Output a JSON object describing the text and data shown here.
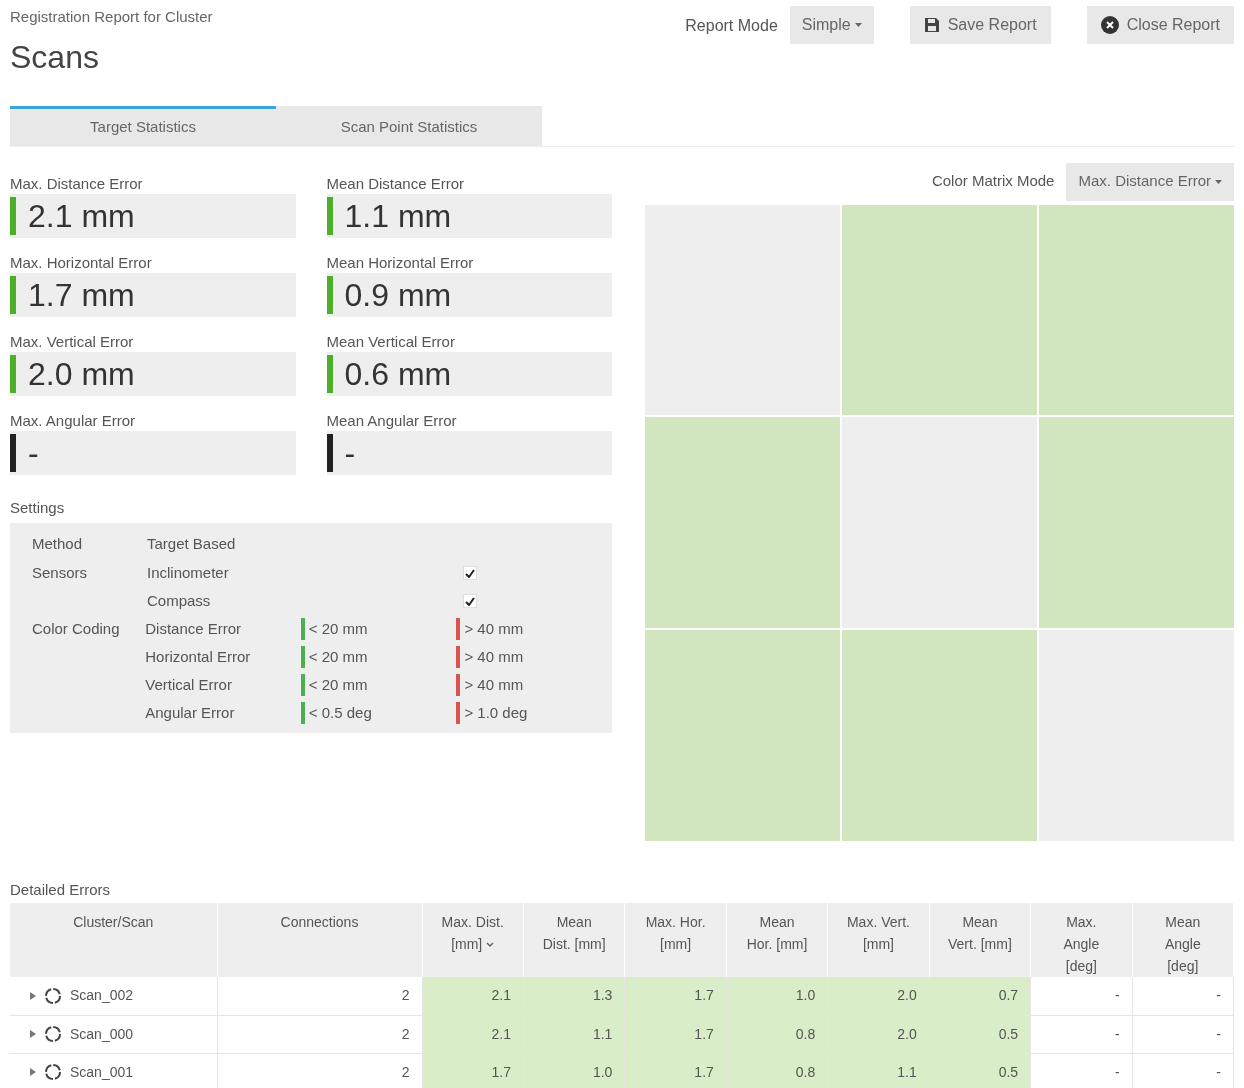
{
  "header": {
    "subtitle": "Registration Report for Cluster",
    "title": "Scans",
    "report_mode_label": "Report Mode",
    "report_mode": "Simple",
    "save_button": "Save Report",
    "close_button": "Close Report"
  },
  "tabs": [
    {
      "label": "Target Statistics",
      "selected": true
    },
    {
      "label": "Scan Point Statistics",
      "selected": false
    }
  ],
  "stats": [
    {
      "label": "Max. Distance Error",
      "value": "2.1 mm",
      "color": "#4caf2a"
    },
    {
      "label": "Mean Distance Error",
      "value": "1.1 mm",
      "color": "#4caf2a"
    },
    {
      "label": "Max. Horizontal Error",
      "value": "1.7 mm",
      "color": "#4caf2a"
    },
    {
      "label": "Mean Horizontal Error",
      "value": "0.9 mm",
      "color": "#4caf2a"
    },
    {
      "label": "Max. Vertical Error",
      "value": "2.0 mm",
      "color": "#4caf2a"
    },
    {
      "label": "Mean Vertical Error",
      "value": "0.6 mm",
      "color": "#4caf2a"
    },
    {
      "label": "Max. Angular Error",
      "value": "-",
      "color": "#222222"
    },
    {
      "label": "Mean Angular Error",
      "value": "-",
      "color": "#222222"
    }
  ],
  "settings": {
    "title": "Settings",
    "method_label": "Method",
    "method": "Target Based",
    "sensors_label": "Sensors",
    "sensors": [
      {
        "name": "Inclinometer",
        "checked": true
      },
      {
        "name": "Compass",
        "checked": true
      }
    ],
    "color_coding_label": "Color Coding",
    "color_coding": [
      {
        "name": "Distance Error",
        "thresholds": [
          {
            "text": "< 20 mm",
            "color": "#4caf50"
          },
          {
            "text": "> 40 mm",
            "color": "#d9534f"
          }
        ]
      },
      {
        "name": "Horizontal Error",
        "thresholds": [
          {
            "text": "< 20 mm",
            "color": "#4caf50"
          },
          {
            "text": "> 40 mm",
            "color": "#d9534f"
          }
        ]
      },
      {
        "name": "Vertical Error",
        "thresholds": [
          {
            "text": "< 20 mm",
            "color": "#4caf50"
          },
          {
            "text": "> 40 mm",
            "color": "#d9534f"
          }
        ]
      },
      {
        "name": "Angular Error",
        "thresholds": [
          {
            "text": "< 0.5 deg",
            "color": "#4caf50"
          },
          {
            "text": "> 1.0 deg",
            "color": "#d9534f"
          }
        ]
      }
    ]
  },
  "color_matrix": {
    "mode_label": "Color Matrix Mode",
    "mode": "Max. Distance Error",
    "cells": [
      {
        "color": "#eeeeee"
      },
      {
        "color": "#d1e6be"
      },
      {
        "color": "#d1e6be"
      },
      {
        "color": "#d1e6be"
      },
      {
        "color": "#eeeeee"
      },
      {
        "color": "#d1e6be"
      },
      {
        "color": "#d1e6be"
      },
      {
        "color": "#d1e6be"
      },
      {
        "color": "#eeeeee"
      }
    ]
  },
  "table": {
    "title": "Detailed Errors",
    "columns": [
      {
        "label": "Cluster/Scan",
        "sorted": false
      },
      {
        "label": "Connections",
        "sorted": false
      },
      {
        "label": "Max. Dist. [mm]",
        "sorted": true
      },
      {
        "label": "Mean Dist. [mm]",
        "sorted": false
      },
      {
        "label": "Max. Hor. [mm]",
        "sorted": false
      },
      {
        "label": "Mean Hor. [mm]",
        "sorted": false
      },
      {
        "label": "Max. Vert. [mm]",
        "sorted": false
      },
      {
        "label": "Mean Vert. [mm]",
        "sorted": false
      },
      {
        "label": "Max. Angle [deg]",
        "sorted": false
      },
      {
        "label": "Mean Angle [deg]",
        "sorted": false
      }
    ],
    "rows": [
      {
        "expanded": false,
        "cells": [
          {
            "text": "Scan_002"
          },
          {
            "text": "2"
          },
          {
            "text": "2.1",
            "color": "#daedc9"
          },
          {
            "text": "1.3",
            "color": "#daedc9"
          },
          {
            "text": "1.7",
            "color": "#daedc9"
          },
          {
            "text": "1.0",
            "color": "#daedc9"
          },
          {
            "text": "2.0",
            "color": "#daedc9"
          },
          {
            "text": "0.7",
            "color": "#daedc9"
          },
          {
            "text": "-"
          },
          {
            "text": "-"
          }
        ]
      },
      {
        "expanded": false,
        "cells": [
          {
            "text": "Scan_000"
          },
          {
            "text": "2"
          },
          {
            "text": "2.1",
            "color": "#daedc9"
          },
          {
            "text": "1.1",
            "color": "#daedc9"
          },
          {
            "text": "1.7",
            "color": "#daedc9"
          },
          {
            "text": "0.8",
            "color": "#daedc9"
          },
          {
            "text": "2.0",
            "color": "#daedc9"
          },
          {
            "text": "0.5",
            "color": "#daedc9"
          },
          {
            "text": "-"
          },
          {
            "text": "-"
          }
        ]
      },
      {
        "expanded": false,
        "cells": [
          {
            "text": "Scan_001"
          },
          {
            "text": "2"
          },
          {
            "text": "1.7",
            "color": "#daedc9"
          },
          {
            "text": "1.0",
            "color": "#daedc9"
          },
          {
            "text": "1.7",
            "color": "#daedc9"
          },
          {
            "text": "0.8",
            "color": "#daedc9"
          },
          {
            "text": "1.1",
            "color": "#daedc9"
          },
          {
            "text": "0.5",
            "color": "#daedc9"
          },
          {
            "text": "-"
          },
          {
            "text": "-"
          }
        ]
      }
    ]
  }
}
